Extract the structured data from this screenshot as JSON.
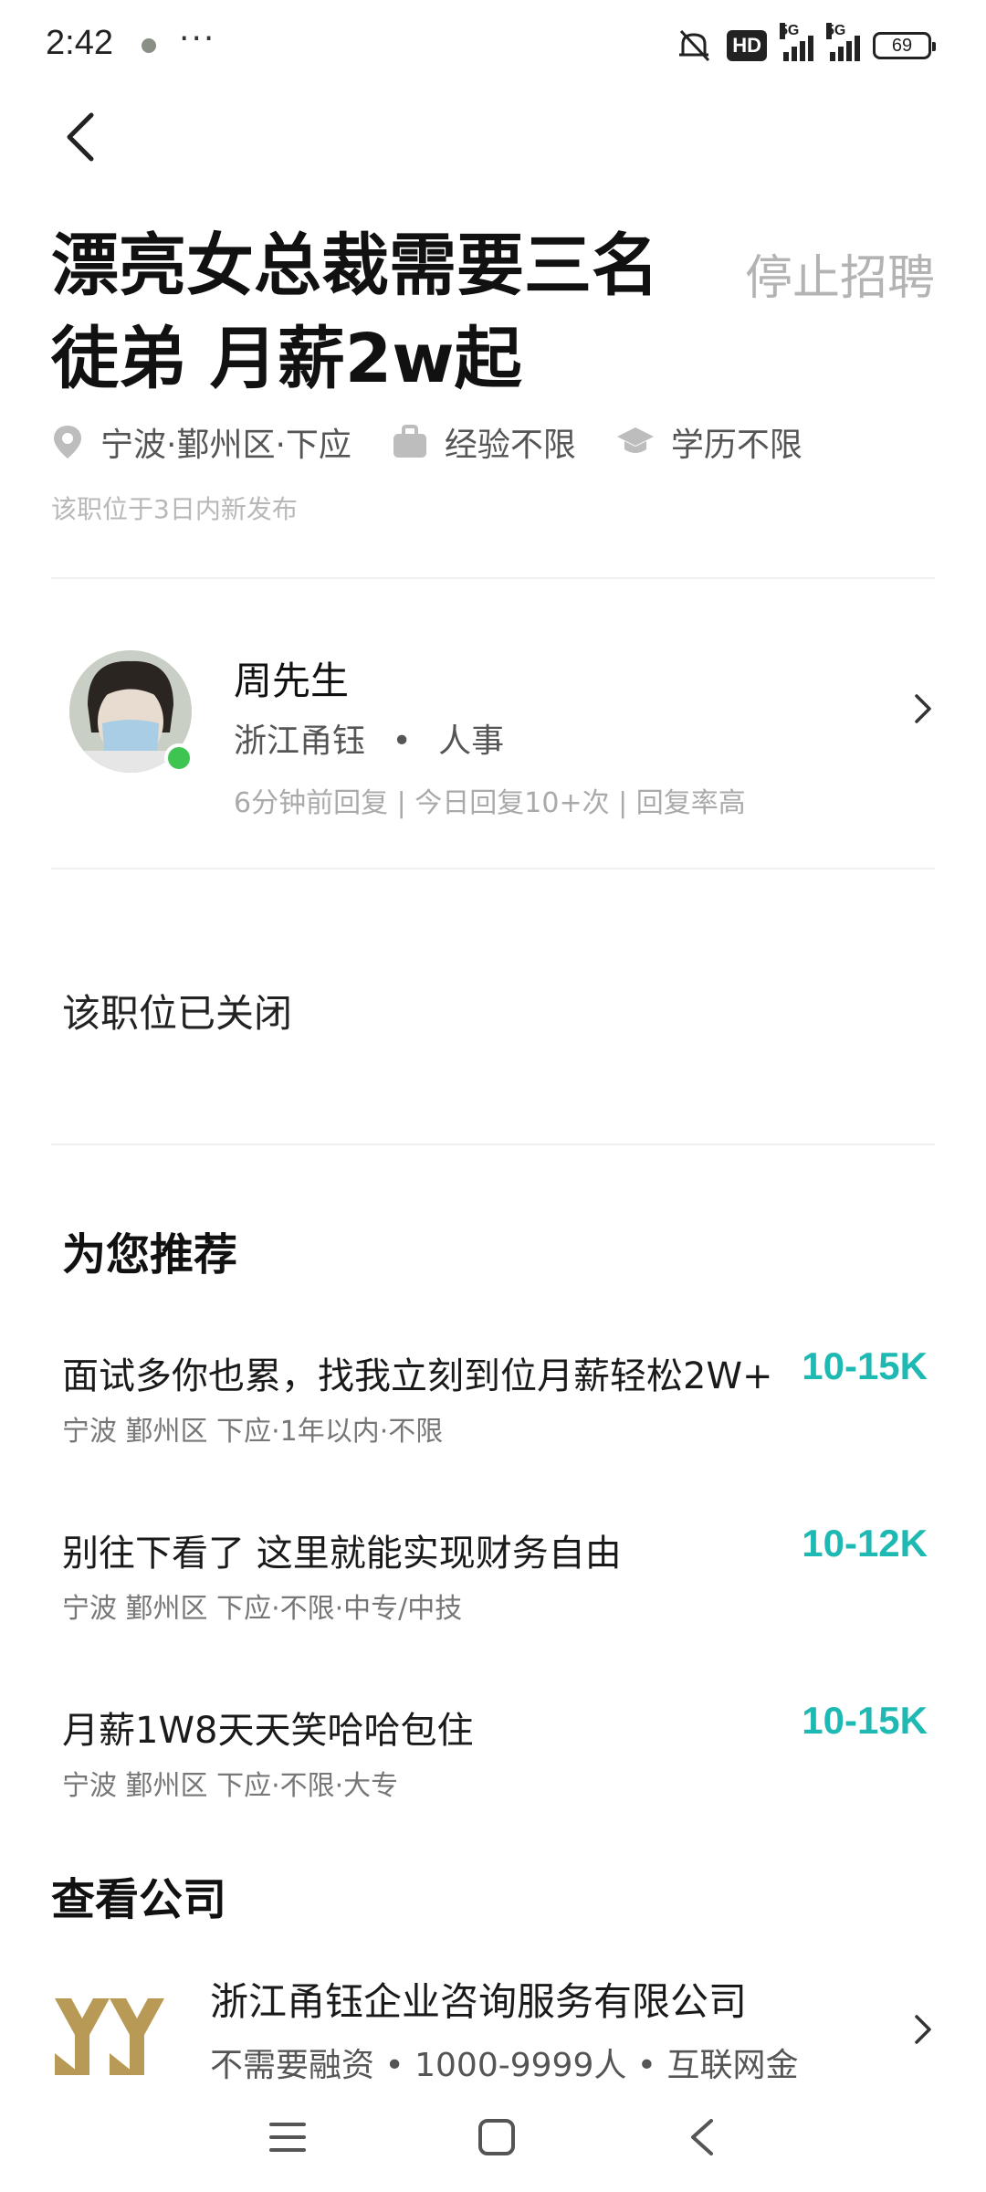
{
  "status_bar": {
    "time": "2:42",
    "more": "···",
    "hd": "HD",
    "net1": "5G",
    "net2": "5G",
    "battery": "69"
  },
  "job": {
    "title": "漂亮女总裁需要三名徒弟 月薪2w起",
    "stop_label": "停止招聘",
    "location": "宁波·鄞州区·下应",
    "experience": "经验不限",
    "education": "学历不限",
    "posted": "该职位于3日内新发布"
  },
  "recruiter": {
    "name": "周先生",
    "company": "浙江甬钰",
    "separator": "•",
    "role": "人事",
    "reply_info": "6分钟前回复 | 今日回复10+次 | 回复率高"
  },
  "closed_notice": "该职位已关闭",
  "recommend": {
    "title": "为您推荐",
    "jobs": [
      {
        "title": "面试多你也累，找我立刻到位月薪轻松2W+",
        "salary": "10-15K",
        "sub": "宁波 鄞州区 下应·1年以内·不限"
      },
      {
        "title": "别往下看了 这里就能实现财务自由",
        "salary": "10-12K",
        "sub": "宁波 鄞州区 下应·不限·中专/中技"
      },
      {
        "title": "月薪1W8天天笑哈哈包住",
        "salary": "10-15K",
        "sub": "宁波 鄞州区 下应·不限·大专"
      }
    ]
  },
  "company": {
    "section_title": "查看公司",
    "name": "浙江甬钰企业咨询服务有限公司",
    "info": "不需要融资 • 1000-9999人 • 互联网金"
  },
  "colors": {
    "salary": "#1fb9b3",
    "online": "#3ec451",
    "logo": "#b89a56"
  },
  "icons": [
    "back-arrow-icon",
    "location-pin-icon",
    "briefcase-icon",
    "graduation-cap-icon",
    "chevron-right-icon",
    "menu-icon",
    "home-square-icon",
    "back-triangle-icon"
  ]
}
